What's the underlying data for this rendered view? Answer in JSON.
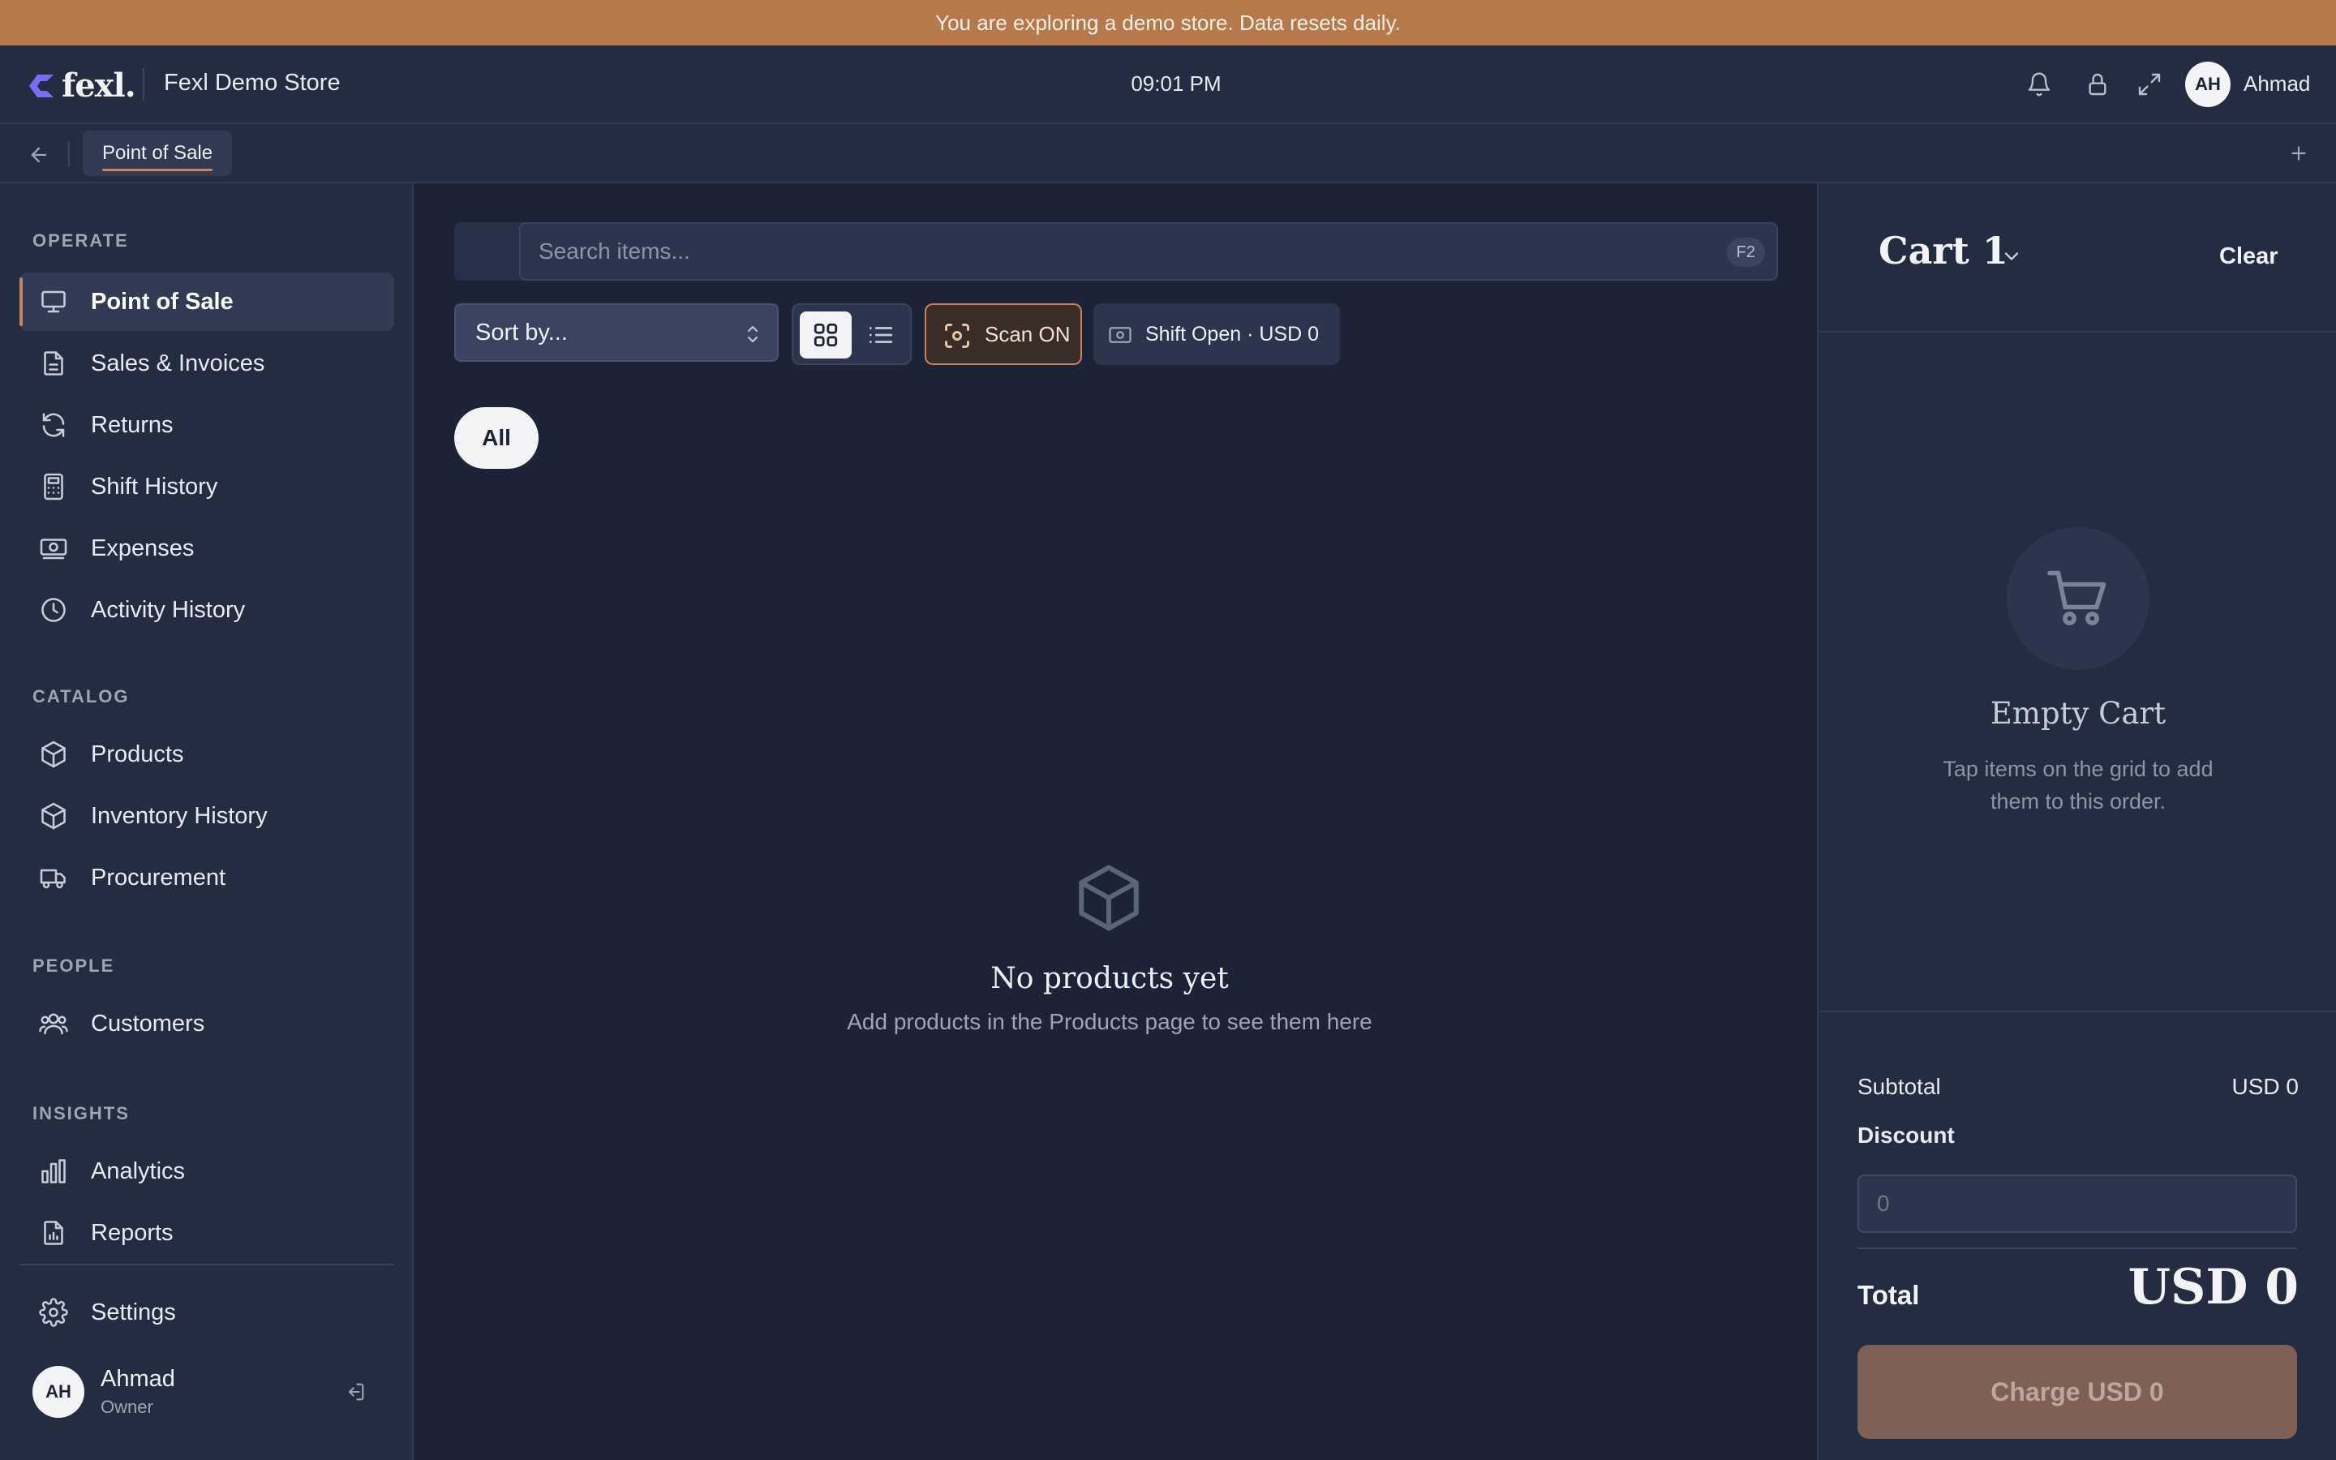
{
  "banner": {
    "text": "You are exploring a demo store. Data resets daily."
  },
  "topbar": {
    "logo_text": "fexl.",
    "store_name": "Fexl Demo Store",
    "time": "09:01 PM",
    "icons": [
      "bell-icon",
      "lock-icon",
      "fullscreen-icon"
    ],
    "user_initials": "AH",
    "user_name": "Ahmad"
  },
  "tabs": {
    "active_label": "Point of Sale"
  },
  "sidebar": {
    "sections": {
      "operate": "OPERATE",
      "catalog": "CATALOG",
      "people": "PEOPLE",
      "insights": "INSIGHTS"
    },
    "items": [
      {
        "label": "Point of Sale",
        "icon": "monitor-icon",
        "active": true
      },
      {
        "label": "Sales & Invoices",
        "icon": "document-icon"
      },
      {
        "label": "Returns",
        "icon": "refresh-icon"
      },
      {
        "label": "Shift History",
        "icon": "calculator-icon"
      },
      {
        "label": "Expenses",
        "icon": "cash-icon"
      },
      {
        "label": "Activity History",
        "icon": "clock-icon"
      },
      {
        "label": "Products",
        "icon": "box-icon"
      },
      {
        "label": "Inventory History",
        "icon": "box-icon"
      },
      {
        "label": "Procurement",
        "icon": "truck-icon"
      },
      {
        "label": "Customers",
        "icon": "users-icon"
      },
      {
        "label": "Analytics",
        "icon": "bar-chart-icon"
      },
      {
        "label": "Reports",
        "icon": "report-icon"
      },
      {
        "label": "Settings",
        "icon": "gear-icon"
      }
    ],
    "user": {
      "initials": "AH",
      "name": "Ahmad",
      "role": "Owner"
    }
  },
  "main": {
    "search_placeholder": "Search items...",
    "search_shortcut": "F2",
    "sort_label": "Sort by...",
    "scan_label": "Scan ON",
    "shift_label": "Shift Open · USD 0",
    "category_chip": "All",
    "empty_title": "No products yet",
    "empty_subtitle": "Add products in the Products page to see them here"
  },
  "cart": {
    "title": "Cart 1",
    "clear_label": "Clear",
    "empty_title": "Empty Cart",
    "empty_subtitle": "Tap items on the grid to add them to this order.",
    "subtotal_label": "Subtotal",
    "subtotal_value": "USD 0",
    "discount_label": "Discount",
    "discount_placeholder": "0",
    "total_label": "Total",
    "total_value": "USD 0",
    "charge_label": "Charge USD 0"
  },
  "colors": {
    "accent": "#c9825a",
    "banner": "#b8794a",
    "background": "#1c2336",
    "panel": "#242c42"
  }
}
